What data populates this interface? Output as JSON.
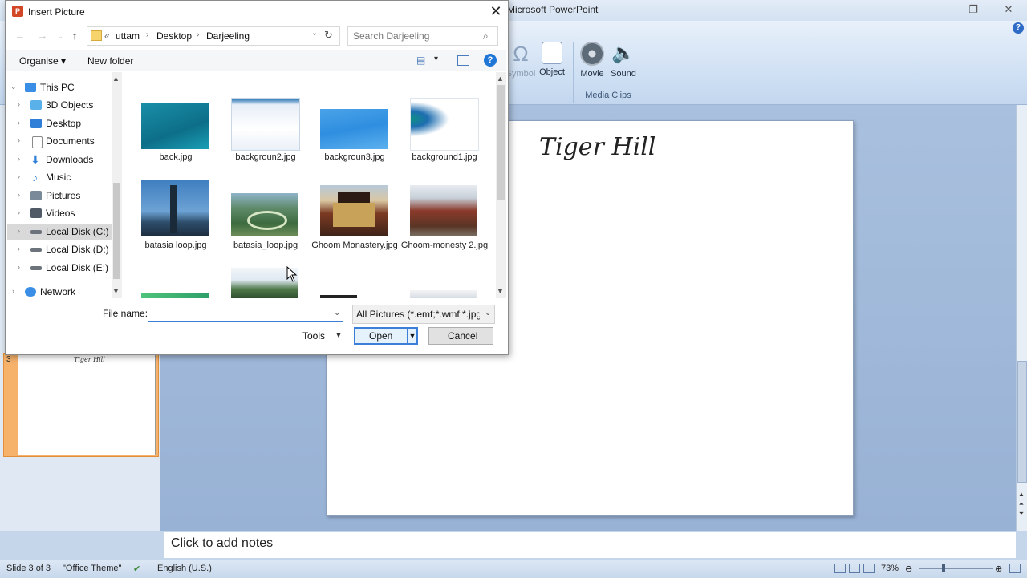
{
  "powerpoint": {
    "title": "Microsoft PowerPoint",
    "ribbon": {
      "buttons": [
        {
          "label": "Symbol",
          "icon": "omega-icon"
        },
        {
          "label": "Object",
          "icon": "object-icon"
        },
        {
          "label": "Movie",
          "icon": "film-reel-icon"
        },
        {
          "label": "Sound",
          "icon": "speaker-icon"
        }
      ],
      "group_label": "Media Clips"
    },
    "slide_title": "Tiger Hill",
    "thumbnail": {
      "number": "3",
      "title": "Tiger Hill"
    },
    "notes_placeholder": "Click to add notes",
    "status": {
      "slide_info": "Slide 3 of 3",
      "theme": "\"Office Theme\"",
      "language": "English (U.S.)",
      "zoom": "73%"
    }
  },
  "dialog": {
    "title": "Insert Picture",
    "breadcrumbs": [
      "uttam",
      "Desktop",
      "Darjeeling"
    ],
    "search_placeholder": "Search Darjeeling",
    "organise_label": "Organise",
    "new_folder_label": "New folder",
    "nav_items": [
      {
        "label": "This PC",
        "icon": "computer-icon",
        "color": "#3a8ee6"
      },
      {
        "label": "3D Objects",
        "icon": "cube-icon",
        "color": "#5ab0e8"
      },
      {
        "label": "Desktop",
        "icon": "desktop-icon",
        "color": "#2f7fd8"
      },
      {
        "label": "Documents",
        "icon": "document-icon",
        "color": "#8a8a8a"
      },
      {
        "label": "Downloads",
        "icon": "download-icon",
        "color": "#2f7fd8"
      },
      {
        "label": "Music",
        "icon": "music-icon",
        "color": "#2f7fd8"
      },
      {
        "label": "Pictures",
        "icon": "pictures-icon",
        "color": "#7a8a99"
      },
      {
        "label": "Videos",
        "icon": "video-icon",
        "color": "#505a66"
      },
      {
        "label": "Local Disk (C:)",
        "icon": "disk-icon",
        "color": "#6c737b"
      },
      {
        "label": "Local Disk (D:)",
        "icon": "disk-icon",
        "color": "#6c737b"
      },
      {
        "label": "Local Disk (E:)",
        "icon": "disk-icon",
        "color": "#6c737b"
      },
      {
        "label": "Network",
        "icon": "network-icon",
        "color": "#3a8ee6"
      }
    ],
    "files": [
      {
        "name": "back.jpg"
      },
      {
        "name": "backgroun2.jpg"
      },
      {
        "name": "backgroun3.jpg"
      },
      {
        "name": "background1.jpg"
      },
      {
        "name": "batasia loop.jpg"
      },
      {
        "name": "batasia_loop.jpg"
      },
      {
        "name": "Ghoom Monastery.jpg"
      },
      {
        "name": "Ghoom-monesty 2.jpg"
      }
    ],
    "file_name_label": "File name:",
    "file_name_value": "",
    "filter": "All Pictures (*.emf;*.wmf;*.jpg;*",
    "tools_label": "Tools",
    "open_label": "Open",
    "cancel_label": "Cancel",
    "accent_color": "#3c7fd9"
  }
}
